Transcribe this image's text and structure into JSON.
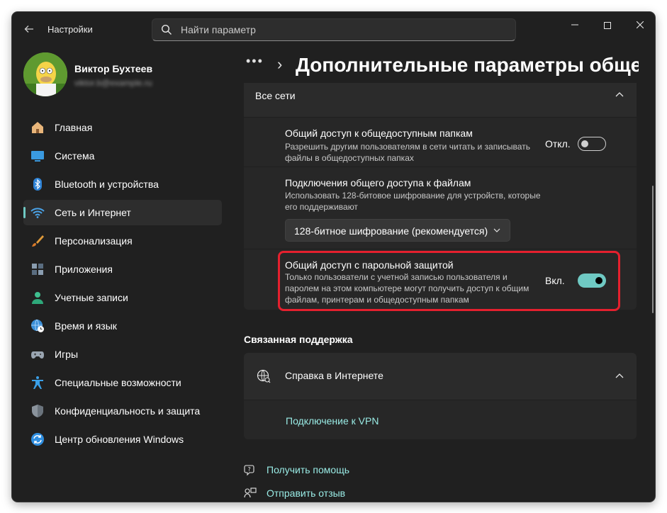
{
  "window": {
    "app_title": "Настройки",
    "controls": {
      "minimize": "—",
      "maximize": "☐",
      "close": "✕"
    }
  },
  "search": {
    "placeholder": "Найти параметр",
    "value": ""
  },
  "profile": {
    "name": "Виктор Бухтеев",
    "email": "viktor.b@example.ru"
  },
  "sidebar": {
    "items": [
      {
        "label": "Главная",
        "icon": "home-icon",
        "active": false
      },
      {
        "label": "Система",
        "icon": "monitor-icon",
        "active": false
      },
      {
        "label": "Bluetooth и устройства",
        "icon": "bluetooth-icon",
        "active": false
      },
      {
        "label": "Сеть и Интернет",
        "icon": "wifi-icon",
        "active": true
      },
      {
        "label": "Персонализация",
        "icon": "brush-icon",
        "active": false
      },
      {
        "label": "Приложения",
        "icon": "apps-icon",
        "active": false
      },
      {
        "label": "Учетные записи",
        "icon": "person-icon",
        "active": false
      },
      {
        "label": "Время и язык",
        "icon": "globe-clock-icon",
        "active": false
      },
      {
        "label": "Игры",
        "icon": "gamepad-icon",
        "active": false
      },
      {
        "label": "Специальные возможности",
        "icon": "accessibility-icon",
        "active": false
      },
      {
        "label": "Конфиденциальность и защита",
        "icon": "shield-icon",
        "active": false
      },
      {
        "label": "Центр обновления Windows",
        "icon": "update-icon",
        "active": false
      }
    ]
  },
  "breadcrumb": {
    "more": "•••",
    "separator": "›",
    "title": "Дополнительные параметры общего доступа"
  },
  "group": {
    "label": "Все сети"
  },
  "settings": {
    "public_folders": {
      "title": "Общий доступ к общедоступным папкам",
      "desc": "Разрешить другим пользователям в сети читать и записывать файлы в общедоступных папках",
      "state_label": "Откл.",
      "on": false
    },
    "file_sharing": {
      "title": "Подключения общего доступа к файлам",
      "desc": "Использовать 128-битовое шифрование для устройств, которые его поддерживают",
      "dropdown_value": "128-битное шифрование (рекомендуется)"
    },
    "password_protected": {
      "title": "Общий доступ с парольной защитой",
      "desc": "Только пользователи с учетной записью пользователя и паролем на этом компьютере могут получить доступ к общим файлам, принтерам и общедоступным папкам",
      "state_label": "Вкл.",
      "on": true
    }
  },
  "support": {
    "section_title": "Связанная поддержка",
    "help_label": "Справка в Интернете",
    "link": "Подключение к VPN"
  },
  "footer": {
    "get_help": "Получить помощь",
    "feedback": "Отправить отзыв"
  },
  "colors": {
    "accent": "#6fc9c3",
    "link": "#99ebe5",
    "highlight": "#e5202e",
    "background": "#202020",
    "card": "#2b2b2b"
  }
}
